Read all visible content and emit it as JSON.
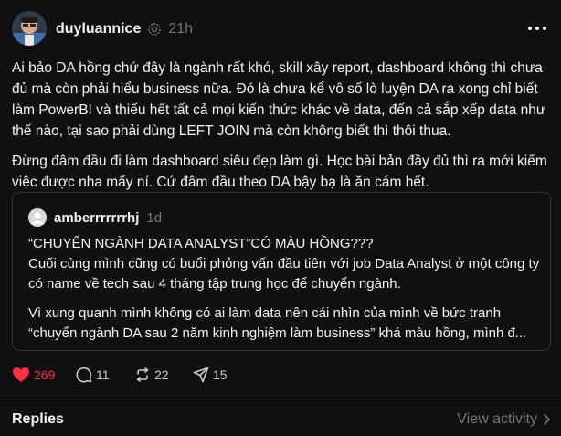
{
  "post": {
    "username": "duyluannice",
    "time": "21h",
    "paragraphs": [
      "Ai bảo DA hồng chứ đây là ngành rất khó, skill xây report, dashboard không thì chưa đủ mà còn phải hiểu business nữa. Đó là chưa kể vô số lò luyện DA ra xong chỉ biết làm PowerBI và thiếu hết tất cả mọi kiến thức khác về data, đến cả sắp xếp data như thế nào, tại sao phải dùng LEFT JOIN mà còn không biết thì thôi thua.",
      "Đừng đâm đầu đi làm dashboard siêu đẹp làm gì. Học bài bản đầy đủ thì ra mới kiếm việc được nha mấy ní. Cứ đâm đầu theo DA bậy bạ là ăn cám hết."
    ]
  },
  "quote": {
    "username": "amberrrrrrrhj",
    "time": "1d",
    "line1": "“CHUYỂN NGÀNH DATA ANALYST”CÓ MÀU HỒNG???",
    "line2": "Cuối cùng mình cũng có buổi phỏng vấn đầu tiên với job Data Analyst ở một công ty có name về tech sau 4 tháng tập trung học để chuyển ngành.",
    "paragraph2": "Vì xung quanh mình không có ai làm data nên cái nhìn của mình về bức tranh “chuyển ngành DA sau 2 năm kinh nghiệm làm business” khá màu hồng, mình đ..."
  },
  "actions": {
    "likes": "269",
    "replies": "11",
    "reposts": "22",
    "shares": "15"
  },
  "footer": {
    "replies_label": "Replies",
    "view_activity_label": "View activity"
  },
  "colors": {
    "background": "#101010",
    "text": "#f3f5f7",
    "muted": "#777777",
    "like": "#ff3040",
    "border": "#333638"
  }
}
